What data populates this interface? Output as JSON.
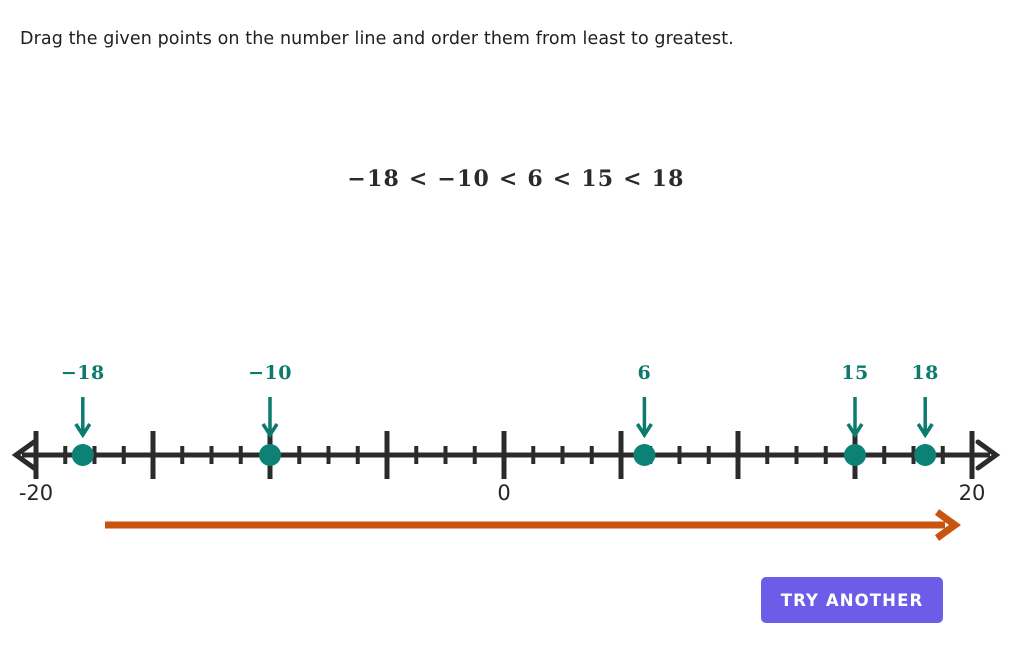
{
  "prompt": {
    "text": "Drag the given points on the number line and order them from least to greatest."
  },
  "expression": {
    "text": "−18 < −10 < 6 < 15 < 18"
  },
  "number_line": {
    "min": -20,
    "max": 20,
    "zero_label": "0",
    "min_label": "-20",
    "max_label": "20",
    "major_tick_step": 5,
    "minor_tick_step": 1.25,
    "line_color": "#2b2b2b",
    "point_color": "#0c8277",
    "label_color": "#0c7a6d",
    "points": [
      {
        "value": -18,
        "label": "−18"
      },
      {
        "value": -10,
        "label": "−10"
      },
      {
        "value": 6,
        "label": "6"
      },
      {
        "value": 15,
        "label": "15"
      },
      {
        "value": 18,
        "label": "18"
      }
    ],
    "axis_labels": [
      {
        "value": -20,
        "text": "-20"
      },
      {
        "value": 0,
        "text": "0"
      },
      {
        "value": 20,
        "text": "20"
      }
    ]
  },
  "progress_arrow": {
    "color": "#c9540f"
  },
  "controls": {
    "try_another_label": "TRY ANOTHER",
    "try_another_color": "#6c5ce7"
  },
  "chart_data": {
    "type": "scatter",
    "title": "",
    "xlabel": "",
    "ylabel": "",
    "xlim": [
      -20,
      20
    ],
    "grid": false,
    "categories": [
      "−18",
      "−10",
      "6",
      "15",
      "18"
    ],
    "values": [
      -18,
      -10,
      6,
      15,
      18
    ],
    "tick_labels": [
      "-20",
      "0",
      "20"
    ],
    "annotations": [
      "−18 < −10 < 6 < 15 < 18"
    ]
  }
}
